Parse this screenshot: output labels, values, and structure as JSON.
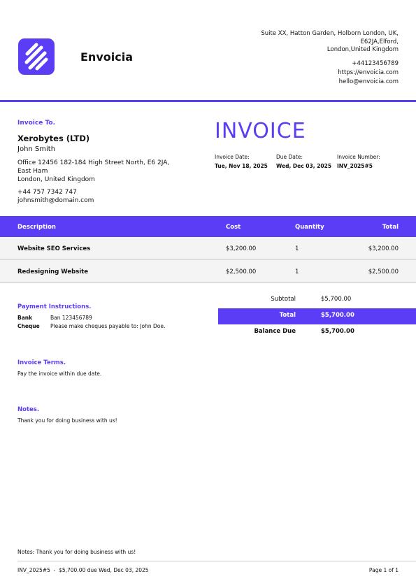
{
  "company": {
    "name": "Envoicia",
    "address_lines": [
      "Suite XX, Hatton Garden, Holborn London, UK,",
      "E62JA,Elford,",
      "London,United Kingdom"
    ],
    "phone": "+44123456789",
    "website": "https://envoicia.com",
    "email": "hello@envoicia.com",
    "logo_icon": "stripes-logo-icon",
    "accent_color": "#5b3df5"
  },
  "bill_to": {
    "label": "Invoice To.",
    "company": "Xerobytes (LTD)",
    "name": "John Smith",
    "address": "Office 12456 182-184 High Street North, E6 2JA, East Ham",
    "city": "London, United Kingdom",
    "phone": "+44 757 7342 747",
    "email": "johnsmith@domain.com"
  },
  "invoice": {
    "title": "INVOICE",
    "date_label": "Invoice Date:",
    "date": "Tue, Nov 18, 2025",
    "due_label": "Due Date:",
    "due": "Wed, Dec 03, 2025",
    "number_label": "Invoice Number:",
    "number": "INV_2025#5"
  },
  "table": {
    "headers": [
      "Description",
      "Cost",
      "Quantity",
      "Total"
    ],
    "rows": [
      {
        "description": "Website SEO Services",
        "cost": "$3,200.00",
        "quantity": "1",
        "total": "$3,200.00"
      },
      {
        "description": "Redesigning Website",
        "cost": "$2,500.00",
        "quantity": "1",
        "total": "$2,500.00"
      }
    ]
  },
  "payment": {
    "label": "Payment Instructions.",
    "items": [
      {
        "key": "Bank",
        "value": "Ban 123456789"
      },
      {
        "key": "Cheque",
        "value": "Please make cheques payable to: John Doe."
      }
    ]
  },
  "totals": {
    "subtotal_label": "Subtotal",
    "subtotal": "$5,700.00",
    "total_label": "Total",
    "total": "$5,700.00",
    "balance_label": "Balance Due",
    "balance": "$5,700.00"
  },
  "terms": {
    "label": "Invoice Terms.",
    "text": "Pay the invoice within due date."
  },
  "notes": {
    "label": "Notes.",
    "text": "Thank you for doing business with us!"
  },
  "footer": {
    "note": "Notes: Thank you for doing business with us!",
    "summary": "INV_2025#5  -  $5,700.00 due Wed, Dec 03, 2025",
    "page": "Page 1 of 1"
  }
}
